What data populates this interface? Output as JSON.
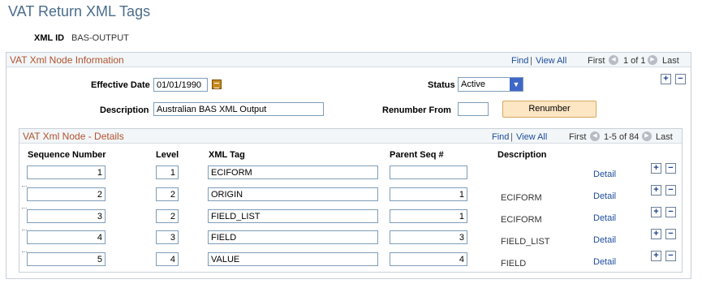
{
  "page": {
    "title": "VAT Return XML Tags"
  },
  "xml_id": {
    "label": "XML ID",
    "value": "BAS-OUTPUT"
  },
  "node_info": {
    "title": "VAT Xml Node Information",
    "nav": {
      "find": "Find",
      "view_all": "View All",
      "first": "First",
      "range": "1 of 1",
      "last": "Last",
      "sep": "|"
    },
    "effective_date_label": "Effective Date",
    "effective_date": "01/01/1990",
    "status_label": "Status",
    "status_value": "Active",
    "description_label": "Description",
    "description_value": "Australian BAS XML Output",
    "renumber_from_label": "Renumber From",
    "renumber_from_value": "",
    "renumber_button": "Renumber",
    "add": "+",
    "remove": "−"
  },
  "details": {
    "title": "VAT Xml Node - Details",
    "nav": {
      "find": "Find",
      "view_all": "View All",
      "first": "First",
      "range": "1-5 of 84",
      "last": "Last",
      "sep": "|"
    },
    "columns": [
      "Sequence Number",
      "Level",
      "XML Tag",
      "Parent Seq #",
      "Description"
    ],
    "detail_link": "Detail",
    "add": "+",
    "remove": "−",
    "rows": [
      {
        "seq": "1",
        "level": "1",
        "tag": "ECIFORM",
        "parent": "",
        "description": ""
      },
      {
        "seq": "2",
        "level": "2",
        "tag": "ORIGIN",
        "parent": "1",
        "description": "ECIFORM"
      },
      {
        "seq": "3",
        "level": "2",
        "tag": "FIELD_LIST",
        "parent": "1",
        "description": "ECIFORM"
      },
      {
        "seq": "4",
        "level": "3",
        "tag": "FIELD",
        "parent": "3",
        "description": "FIELD_LIST"
      },
      {
        "seq": "5",
        "level": "4",
        "tag": "VALUE",
        "parent": "4",
        "description": "FIELD"
      }
    ]
  }
}
